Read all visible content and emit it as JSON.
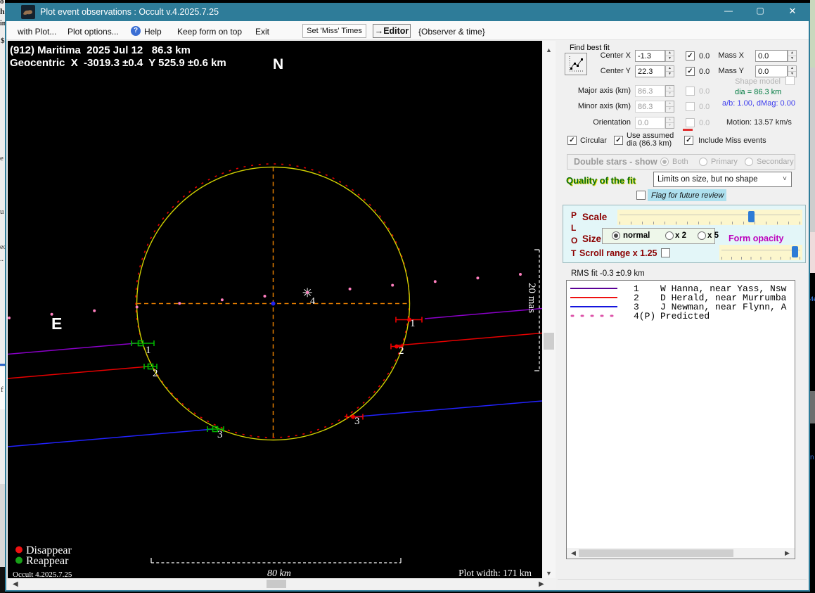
{
  "window": {
    "title": "Plot event observations : Occult v.4.2025.7.25",
    "minimize_glyph": "—",
    "maximize_glyph": "▢",
    "close_glyph": "✕"
  },
  "menu": {
    "items": [
      "with Plot...",
      "Plot options...",
      "Help",
      "Keep form on top",
      "Exit"
    ],
    "set_miss_times_button": "Set 'Miss' Times",
    "editor_button": "→Editor",
    "observer_time_label": "{Observer & time}"
  },
  "plot": {
    "header_line1": "(912) Maritima  2025 Jul 12   86.3 km",
    "header_line2": "Geocentric  X  -3019.3 ±0.4  Y 525.9 ±0.6 km",
    "north_label": "N",
    "east_label": "E",
    "legend": {
      "disappear": "Disappear",
      "reappear": "Reappear"
    },
    "version": "Occult 4.2025.7.25",
    "h_scale_label": "80 km",
    "v_scale_label": "20 mas",
    "plot_width_label": "Plot width: 171 km",
    "chords": [
      {
        "id": "1",
        "color": "#8a00c8"
      },
      {
        "id": "2",
        "color": "#e80000"
      },
      {
        "id": "3",
        "color": "#2222ff"
      },
      {
        "id": "4",
        "color": "#ff7fbf"
      }
    ],
    "colors": {
      "circle": "#d0d000",
      "predicted_circle": "#e00000",
      "crosshair": "#e67e00",
      "center_dot": "#2222ee",
      "disappear_marker": "#ee0000",
      "reappear_marker": "#00b400"
    }
  },
  "fit_panel": {
    "group_label": "Find best fit",
    "center_x_label": "Center X",
    "center_x_value": "-1.3",
    "center_x_extra": "0.0",
    "center_y_label": "Center Y",
    "center_y_value": "22.3",
    "center_y_extra": "0.0",
    "mass_x_label": "Mass X",
    "mass_x_value": "0.0",
    "mass_y_label": "Mass Y",
    "mass_y_value": "0.0",
    "shape_model_label": "Shape model",
    "major_axis_label": "Major axis (km)",
    "major_axis_value": "86.3",
    "major_axis_extra": "0.0",
    "minor_axis_label": "Minor axis (km)",
    "minor_axis_value": "86.3",
    "minor_axis_extra": "0.0",
    "orientation_label": "Orientation",
    "orientation_value": "0.0",
    "orientation_extra": "0.0",
    "dia_text": "dia = 86.3 km",
    "ab_text": "a/b: 1.00, dMag: 0.00",
    "motion_text": "Motion: 13.57 km/s",
    "circular_label": "Circular",
    "use_assumed_label_1": "Use assumed",
    "use_assumed_label_2": "dia (86.3 km)",
    "include_miss_label": "Include Miss events"
  },
  "double_stars": {
    "label": "Double stars - show",
    "options": [
      "Both",
      "Primary",
      "Secondary"
    ]
  },
  "quality": {
    "label": "Quality of the fit",
    "value": "Limits on size, but no shape",
    "flag_label": "Flag for future review"
  },
  "plot_controls": {
    "letters": [
      "P",
      "L",
      "O",
      "T"
    ],
    "scale_label": "Scale",
    "size_label": "Size",
    "size_options": [
      "normal",
      "x 2",
      "x 5"
    ],
    "form_opacity_label": "Form opacity",
    "scroll_range_label": "Scroll range x 1.25"
  },
  "rms_label": "RMS fit -0.3 ±0.9 km",
  "observations": {
    "rows": [
      {
        "num": "1",
        "name": "W Hanna, near Yass, Nsw",
        "color": "#5a0096",
        "style": "solid"
      },
      {
        "num": "2",
        "name": "D Herald, near Murrumba",
        "color": "#ee1111",
        "style": "solid"
      },
      {
        "num": "3",
        "name": "J Newman, near Flynn, A",
        "color": "#1515dd",
        "style": "solid"
      },
      {
        "num": "4(P)",
        "name": "Predicted",
        "color": "#dd55aa",
        "style": "dotted"
      }
    ]
  }
}
